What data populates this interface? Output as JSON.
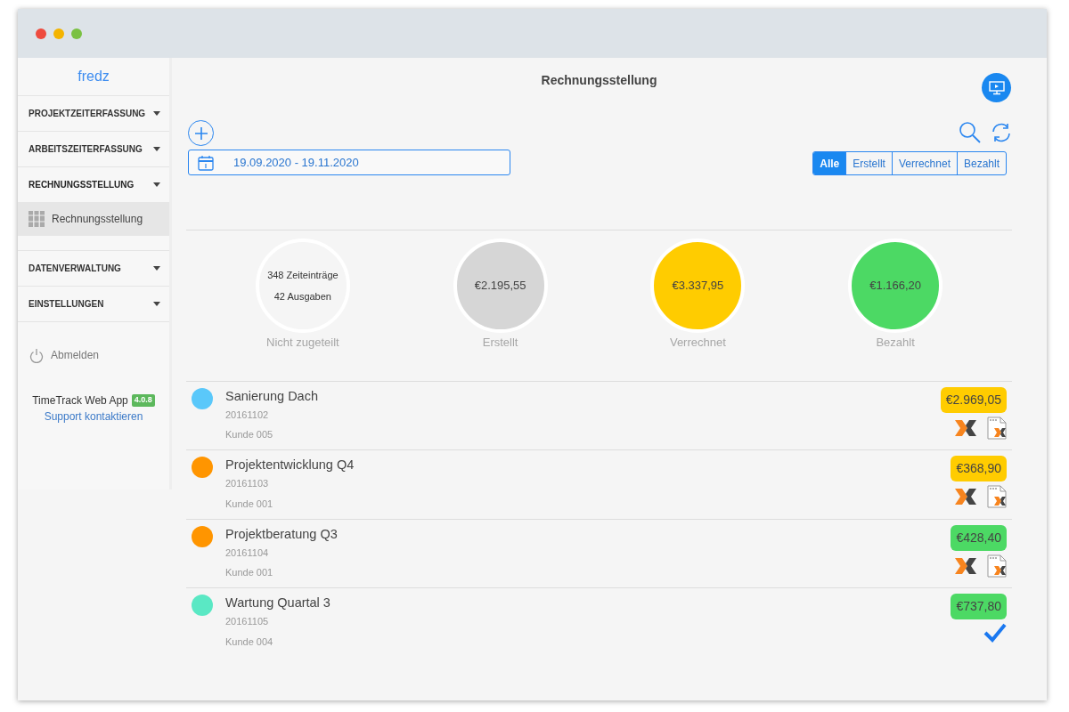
{
  "sidebar": {
    "user": "fredz",
    "sections": [
      {
        "label": "PROJEKTZEITERFASSUNG",
        "expanded": false
      },
      {
        "label": "ARBEITSZEITERFASSUNG",
        "expanded": false
      },
      {
        "label": "RECHNUNGSSTELLUNG",
        "expanded": true,
        "children": [
          {
            "label": "Rechnungsstellung",
            "selected": true
          }
        ]
      },
      {
        "label": "DATENVERWALTUNG",
        "expanded": false
      },
      {
        "label": "EINSTELLUNGEN",
        "expanded": false
      }
    ],
    "logout": "Abmelden",
    "app_name": "TimeTrack Web App",
    "version": "4.0.8",
    "support_link": "Support kontaktieren"
  },
  "page_title": "Rechnungsstellung",
  "date_range": "19.09.2020 - 19.11.2020",
  "filters": [
    {
      "label": "Alle",
      "selected": true
    },
    {
      "label": "Erstellt",
      "selected": false
    },
    {
      "label": "Verrechnet",
      "selected": false
    },
    {
      "label": "Bezahlt",
      "selected": false
    }
  ],
  "summary": [
    {
      "kind": "counts",
      "lines": [
        "348 Zeiteinträge",
        "42 Ausgaben"
      ],
      "label": "Nicht zugeteilt",
      "color": "#f5f5f5"
    },
    {
      "kind": "amount",
      "lines": [
        "€2.195,55"
      ],
      "label": "Erstellt",
      "color": "#d6d6d6"
    },
    {
      "kind": "amount",
      "lines": [
        "€3.337,95"
      ],
      "label": "Verrechnet",
      "color": "#ffcc00"
    },
    {
      "kind": "amount",
      "lines": [
        "€1.166,20"
      ],
      "label": "Bezahlt",
      "color": "#4cd964"
    }
  ],
  "invoices": [
    {
      "name": "Sanierung Dach",
      "number": "20161102",
      "customer": "Kunde 005",
      "color": "#5ac8fa",
      "amount_badge": {
        "text": "€2.969,05",
        "color": "#ffcc00"
      },
      "kind": "export"
    },
    {
      "name": "Projektentwicklung Q4",
      "number": "20161103",
      "customer": "Kunde 001",
      "color": "#ff9500",
      "amount_badge": {
        "text": "€368,90",
        "color": "#ffcc00"
      },
      "kind": "export"
    },
    {
      "name": "Projektberatung Q3",
      "number": "20161104",
      "customer": "Kunde 001",
      "color": "#ff9500",
      "amount_badge": {
        "text": "€428,40",
        "color": "#4cd964"
      },
      "kind": "export"
    },
    {
      "name": "Wartung Quartal 3",
      "number": "20161105",
      "customer": "Kunde 004",
      "color": "#5ae8c4",
      "amount_badge": {
        "text": "€737,80",
        "color": "#4cd964"
      },
      "kind": "done"
    }
  ]
}
